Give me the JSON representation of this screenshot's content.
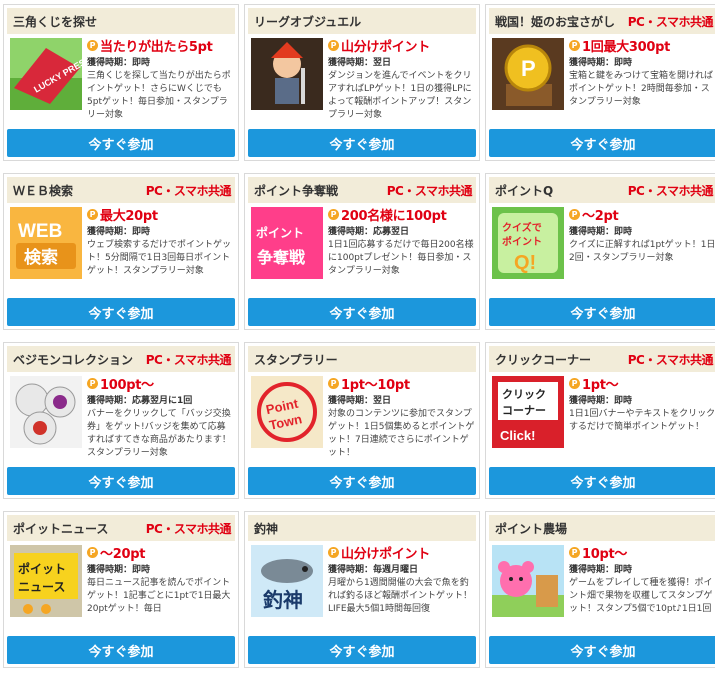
{
  "timing_label": "獲得時期：",
  "button_label": "今すぐ参加",
  "pc_badge": "PC・スマホ共通",
  "cards": [
    {
      "title": "三角くじを探せ",
      "reward": "当たりが出たら5pt",
      "timing": "即時",
      "desc": "三角くじを探して当たりが出たらポイントゲット！さらにWくじでも5ptゲット！毎日参加・スタンプラリー対象",
      "icon": "lucky-present-icon",
      "thumb_text": "LUCKY PRESENT",
      "pc": false
    },
    {
      "title": "リーグオブジュエル",
      "reward": "山分けポイント",
      "timing": "翌日",
      "desc": "ダンジョンを進んでイベントをクリアすればLPゲット！1日の獲得LPによって報酬ポイントアップ！スタンプラリー対象",
      "icon": "hero-character-icon",
      "thumb_text": "",
      "pc": false
    },
    {
      "title": "戦国！姫のお宝さがし",
      "reward": "1回最大300pt",
      "timing": "即時",
      "desc": "宝箱と鍵をみつけて宝箱を開ければポイントゲット！2時間毎参加・スタンプラリー対象",
      "icon": "treasure-coin-icon",
      "thumb_text": "P",
      "pc": true
    },
    {
      "title": "ＷＥＢ検索",
      "reward": "最大20pt",
      "timing": "即時",
      "desc": "ウェブ検索するだけでポイントゲット！5分間隔で1日3回毎日ポイントゲット！スタンプラリー対象",
      "icon": "web-search-icon",
      "thumb_text": "WEB 検索",
      "pc": true
    },
    {
      "title": "ポイント争奪戦",
      "reward": "200名様に100pt",
      "timing": "応募翌日",
      "desc": "1日1回応募するだけで毎日200名様に100ptプレゼント！毎日参加・スタンプラリー対象",
      "icon": "point-battle-icon",
      "thumb_text": "ポイント 争奪戦",
      "pc": true
    },
    {
      "title": "ポイントQ",
      "reward": "～2pt",
      "timing": "即時",
      "desc": "クイズに正解すれば1ptゲット！1日2回・スタンプラリー対象",
      "icon": "quiz-point-icon",
      "thumb_text": "クイズでポイント Q!",
      "pc": true
    },
    {
      "title": "ベジモンコレクション",
      "reward": "100pt～",
      "timing": "応募翌月に1回",
      "desc": "バナーをクリックして「バッジ交換券」をゲット!バッジを集めて応募すればすてきな商品があたります！スタンプラリー対象",
      "icon": "badge-collection-icon",
      "thumb_text": "",
      "pc": true
    },
    {
      "title": "スタンプラリー",
      "reward": "1pt～10pt",
      "timing": "翌日",
      "desc": "対象のコンテンツに参加でスタンプゲット！1日5個集めるとポイントゲット！7日連続でさらにポイントゲット！",
      "icon": "point-town-stamp-icon",
      "thumb_text": "Point Town",
      "pc": false
    },
    {
      "title": "クリックコーナー",
      "reward": "1pt～",
      "timing": "即時",
      "desc": "1日1回バナーやテキストをクリックするだけで簡単ポイントゲット！",
      "icon": "click-corner-icon",
      "thumb_text": "クリック コーナー Click!",
      "pc": true
    },
    {
      "title": "ポイットニュース",
      "reward": "～20pt",
      "timing": "即時",
      "desc": "毎日ニュース記事を読んでポイントゲット！1記事ごとに1ptで1日最大20ptゲット！毎日",
      "icon": "news-icon",
      "thumb_text": "ポイット ニュース",
      "pc": true
    },
    {
      "title": "釣神",
      "reward": "山分けポイント",
      "timing": "毎週月曜日",
      "desc": "月曜から1週間開催の大会で魚を釣れば釣るほど報酬ポイントゲット！LIFE最大5個1時間毎回復",
      "icon": "fishing-icon",
      "thumb_text": "釣神",
      "pc": false
    },
    {
      "title": "ポイント農場",
      "reward": "10pt～",
      "timing": "即時",
      "desc": "ゲームをプレイして種を獲得！ポイント畑で果物を収穫してスタンプゲット！スタンプ5個で10pt♪1日1回",
      "icon": "farm-bear-icon",
      "thumb_text": "",
      "pc": false
    }
  ]
}
